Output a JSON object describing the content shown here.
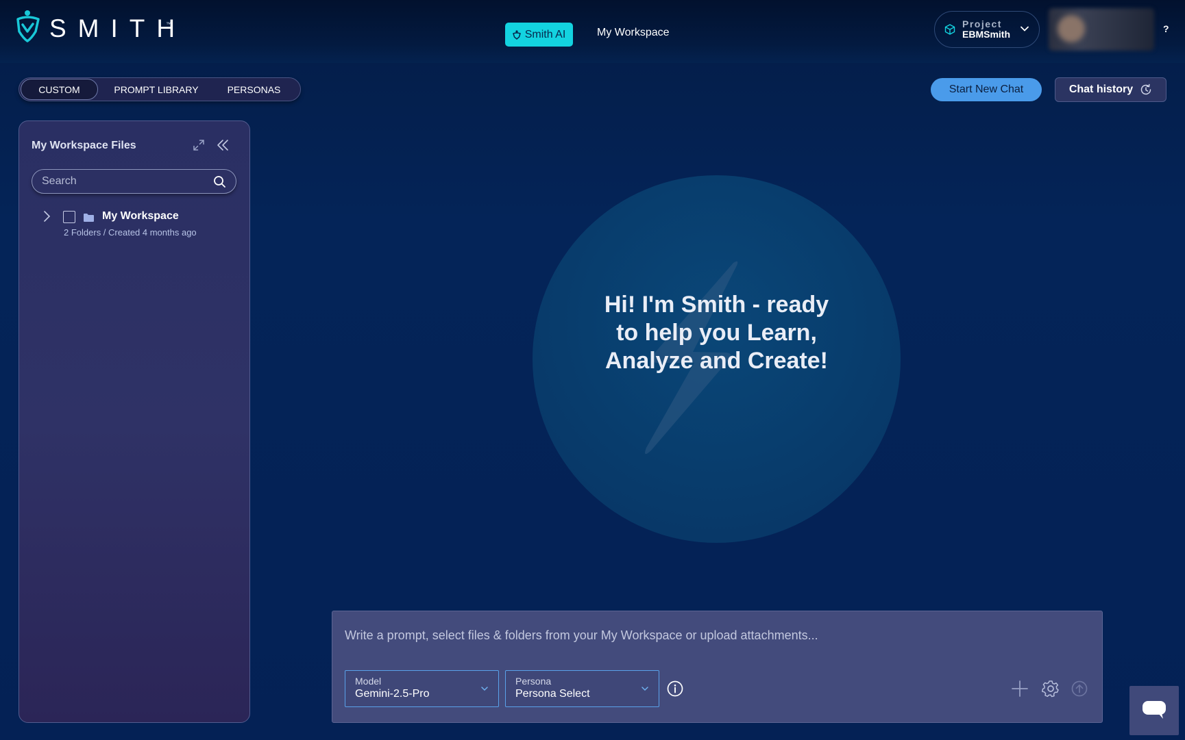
{
  "brand": {
    "name": "SMITH",
    "trademark": "™"
  },
  "nav": {
    "smith_ai_label": "Smith AI",
    "workspace_label": "My Workspace"
  },
  "project": {
    "caption": "Project",
    "name": "EBMSmith"
  },
  "help_label": "?",
  "tabs": [
    {
      "label": "CUSTOM",
      "active": true
    },
    {
      "label": "PROMPT LIBRARY",
      "active": false
    },
    {
      "label": "PERSONAS",
      "active": false
    }
  ],
  "actions": {
    "new_chat_label": "Start New Chat",
    "history_label": "Chat history"
  },
  "sidebar": {
    "title": "My Workspace Files",
    "search_placeholder": "Search",
    "tree": [
      {
        "name": "My Workspace",
        "meta": "2 Folders / Created 4 months ago",
        "checked": false
      }
    ]
  },
  "hero": {
    "greeting": "Hi! I'm Smith - ready to help you Learn, Analyze and Create!"
  },
  "composer": {
    "placeholder": "Write a prompt, select files & folders from your My Workspace or upload attachments...",
    "model": {
      "caption": "Model",
      "value": "Gemini-2.5-Pro"
    },
    "persona": {
      "caption": "Persona",
      "value": "Persona Select"
    }
  },
  "colors": {
    "accent_cyan": "#13d3e0",
    "primary_blue": "#4a9bea",
    "background": "#042458",
    "panel": "#2a2f63"
  },
  "icons": {
    "logo": "shield-logo-icon",
    "project": "cube-icon",
    "expand": "expand-icon",
    "collapse": "double-chevron-left-icon",
    "search": "search-icon",
    "history": "history-icon",
    "info": "info-icon",
    "plus": "plus-icon",
    "settings": "gear-icon",
    "send": "send-arrow-icon",
    "chat": "chat-bubble-icon"
  }
}
